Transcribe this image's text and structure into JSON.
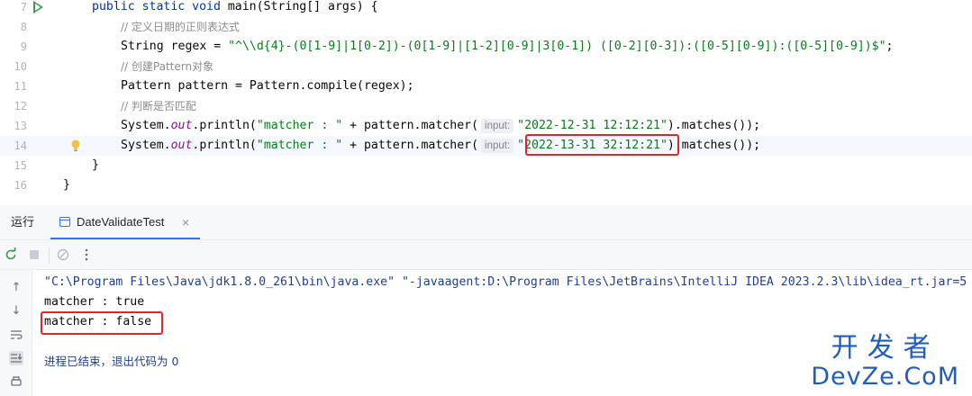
{
  "editor": {
    "lines": [
      {
        "num": "7"
      },
      {
        "num": "8",
        "comment": "// 定义日期的正则表达式"
      },
      {
        "num": "9"
      },
      {
        "num": "10",
        "comment": "// 创建Pattern对象"
      },
      {
        "num": "11"
      },
      {
        "num": "12",
        "comment": "// 判断是否匹配"
      },
      {
        "num": "13",
        "hint": "input:",
        "arg": "\"2022-12-31 12:12:21\""
      },
      {
        "num": "14",
        "hint": "input:",
        "arg": "\"2022-13-31 32:12:21\""
      },
      {
        "num": "15"
      },
      {
        "num": "16"
      }
    ],
    "line7": {
      "kw": "public static void",
      "rest": " main(String[] args) {"
    },
    "line9": {
      "decl": "String regex = ",
      "regex": "\"^\\\\d{4}-(0[1-9]|1[0-2])-(0[1-9]|[1-2][0-9]|3[0-1]) ([0-2][0-3]):([0-5][0-9]):([0-5][0-9])$\"",
      "end": ";"
    },
    "line11": "Pattern pattern = Pattern.compile(regex);",
    "println_prefix": "System.",
    "println_out": "out",
    "println_mid": ".println(",
    "println_str": "\"matcher : \"",
    "println_concat": " + pattern.matcher(",
    "println_end": ").matches());",
    "close_method": "}",
    "close_class": "}"
  },
  "toolwindow": {
    "title": "运行",
    "tab_label": "DateValidateTest",
    "tab_close": "×"
  },
  "console": {
    "command": "\"C:\\Program Files\\Java\\jdk1.8.0_261\\bin\\java.exe\" \"-javaagent:D:\\Program Files\\JetBrains\\IntelliJ IDEA 2023.2.3\\lib\\idea_rt.jar=5",
    "out1": "matcher : true",
    "out2": "matcher : false",
    "finish": "进程已结束，退出代码为 0"
  },
  "watermark": {
    "cn": "开发者",
    "en": "DevZe.CoM"
  },
  "colors": {
    "keyword": "#0033b3",
    "string": "#067d17",
    "comment": "#8c8c8c",
    "field": "#871094",
    "highlight_box": "#e3242b",
    "accent": "#3574f0"
  }
}
